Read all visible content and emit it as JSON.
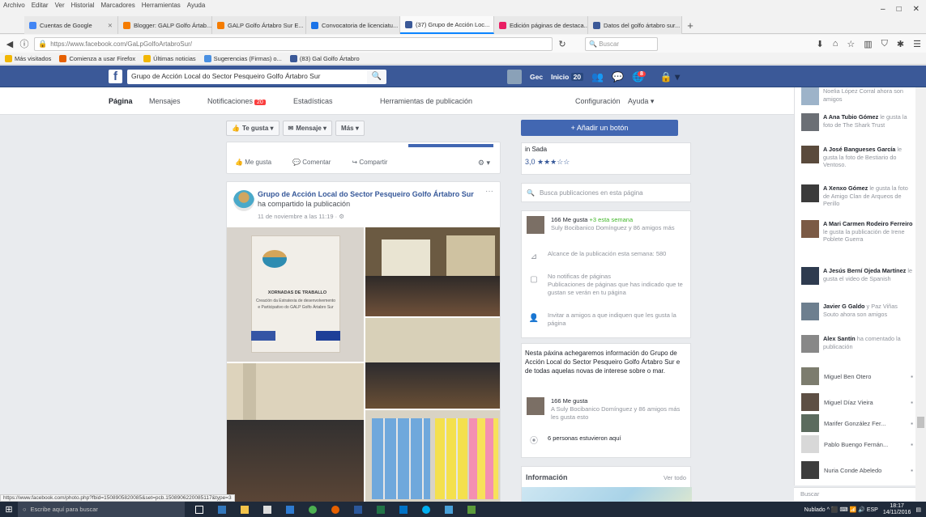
{
  "browser": {
    "menu": [
      "Archivo",
      "Editar",
      "Ver",
      "Historial",
      "Marcadores",
      "Herramientas",
      "Ayuda"
    ],
    "window_controls": [
      "–",
      "□",
      "✕"
    ],
    "tabs": [
      {
        "title": "Cuentas de Google",
        "color": "#4285f4",
        "active": false
      },
      {
        "title": "Blogger: GALP Golfo Ártab...",
        "color": "#f57c00",
        "active": false
      },
      {
        "title": "GALP Golfo Ártabro Sur E...",
        "color": "#f57c00",
        "active": false
      },
      {
        "title": "Convocatoria de licenciatu...",
        "color": "#1a73e8",
        "active": false
      },
      {
        "title": "(37) Grupo de Acción Loc...",
        "color": "#3b5998",
        "active": true
      },
      {
        "title": "Edición páginas de destaca...",
        "color": "#e91e63",
        "active": false
      },
      {
        "title": "Datos del golfo ártabro sur...",
        "color": "#3b5998",
        "active": false
      }
    ],
    "new_tab": "+",
    "url": "https://www.facebook.com/GaLpGolfoArtabroSur/",
    "search_placeholder": "Buscar",
    "bookmarks": [
      {
        "label": "Más visitados",
        "color": "#f2b705"
      },
      {
        "label": "Comienza a usar Firefox",
        "color": "#e66000"
      },
      {
        "label": "Últimas noticias",
        "color": "#f2b705"
      },
      {
        "label": "Sugerencias (Firmas) o...",
        "color": "#4a90e2"
      },
      {
        "label": "(83) Gal Golfo Ártabro",
        "color": "#3b5998"
      }
    ],
    "status_url": "https://www.facebook.com/photo.php?fbid=1508905820085&set=pcb.1508906220085117&type=3"
  },
  "fb": {
    "logo": "f",
    "search_value": "Grupo de Acción Local do Sector Pesqueiro Golfo Ártabro Sur",
    "user_name": "Gec",
    "home_label": "Inicio",
    "home_count": "20",
    "notif_count": "8"
  },
  "page_nav": [
    {
      "label": "Página",
      "active": true
    },
    {
      "label": "Mensajes",
      "active": false
    },
    {
      "label": "Notificaciones",
      "active": false,
      "badge": "20"
    },
    {
      "label": "Estadísticas",
      "active": false
    },
    {
      "label": "Herramientas de publicación",
      "active": false
    }
  ],
  "page_nav_right": [
    "Configuración",
    "Ayuda ▾"
  ],
  "actions": {
    "like": "Te gusta ▾",
    "message": "Mensaje ▾",
    "more": "Más ▾"
  },
  "prev_post": {
    "like": "Me gusta",
    "comment": "Comentar",
    "share": "Compartir",
    "more": "⚙ ▾"
  },
  "post": {
    "author": "Grupo de Acción Local do Sector Pesqueiro Golfo Ártabro Sur",
    "action": "ha compartido la publicación",
    "date": "11 de noviembre a las 11:19 · ⚙",
    "menu": "···",
    "banner": {
      "title": "XORNADAS DE TRABALLO",
      "line1": "Creación da Estratexia de desenvolvemento",
      "line2": "e Participativo do GALP Golfo Ártabro Sur"
    }
  },
  "sidebar": {
    "add_button": "+ Añadir un botón",
    "rating_label": "in Sada",
    "rating_stars": "3,0 ★★★☆☆",
    "search_placeholder": "Busca publicaciones en esta página",
    "stats": {
      "likes": "166 Me gusta",
      "likes_new": "+3 esta semana",
      "likes_friends": "Suly Bocibanico Domínguez y 86 amigos más",
      "reach": "Alcance de la publicación esta semana: 580",
      "no_notif": "No notificas de páginas",
      "no_notif_desc": "Publicaciones de páginas que has indicado que te gustan se verán en tu página",
      "invite": "Invitar a amigos a que indiquen que les gusta la página"
    },
    "about": {
      "desc": "Nesta páxina achegaremos información do Grupo de Acción Local do Sector Pesqueiro Golfo Ártabro Sur e de todas aquelas novas de interese sobre o mar.",
      "likes": "166 Me gusta",
      "likes_friends": "A Suly Bocibanico Domínguez y 86 amigos más les gusta esto",
      "visits": "6 personas estuvieron aquí"
    },
    "info_title": "Información",
    "info_all": "Ver todo"
  },
  "ticker": [
    {
      "name": "",
      "text": "Noelia López Corral ahora son amigos"
    },
    {
      "name": "A Ana Tubio Gómez",
      "text": "le gusta la foto de The Shark Trust"
    },
    {
      "name": "A José Bangueses García",
      "text": "le gusta la foto de Bestiario do Ventoso."
    },
    {
      "name": "A Xenxo Gómez",
      "text": "le gusta la foto de Amigo Clan de Arqueos de Perillo"
    },
    {
      "name": "A Mari Carmen Rodeiro Ferreiro",
      "text": "le gusta la publicación de Irene Poblete Guerra"
    },
    {
      "name": "A Jesús Berní Ojeda Martínez",
      "text": "le gusta el video de Spanish"
    },
    {
      "name": "Javier G Galdo",
      "text": "y Paz Viñas Souto ahora son amigos"
    },
    {
      "name": "Alex Santín",
      "text": "ha comentado la publicación"
    }
  ],
  "contacts": [
    {
      "name": "Miguel Ben Otero"
    },
    {
      "name": "Miguel Díaz Vieira"
    },
    {
      "name": "Marifer González Fer..."
    },
    {
      "name": "Pablo Buengo Fernán..."
    },
    {
      "name": "Nuria Conde Abeledo"
    }
  ],
  "chat_search": "Buscar",
  "taskbar": {
    "search_placeholder": "Escribe aquí para buscar",
    "tray": "Nublado ^ ⬛ ⌨ 📶 🔊 ESP",
    "time": "18:17",
    "date": "14/11/2016"
  }
}
